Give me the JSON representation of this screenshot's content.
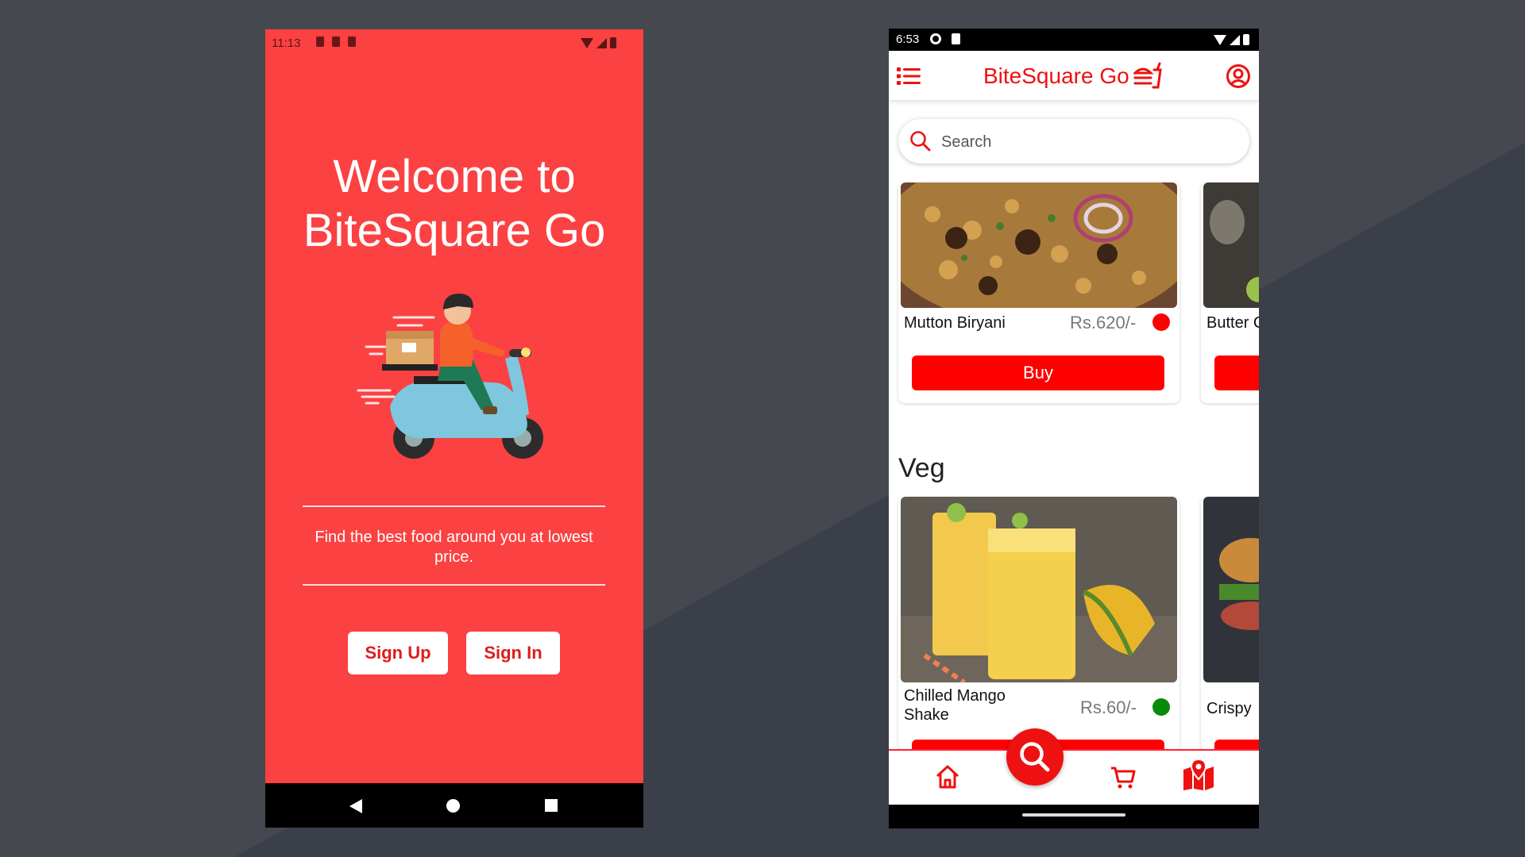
{
  "welcome_screen": {
    "status_time": "11:13",
    "title_line1": "Welcome to",
    "title_line2": "BiteSquare Go",
    "tagline": "Find the best food around you at lowest price.",
    "signup_label": "Sign Up",
    "signin_label": "Sign In",
    "bg_color": "#fb4141"
  },
  "home_screen": {
    "status_time": "6:53",
    "app_title": "BiteSquare Go",
    "search_placeholder": "Search",
    "featured_cards": [
      {
        "name": "Mutton Biryani",
        "price": "Rs.620/-",
        "indicator": "non-veg",
        "indicator_color": "#ff0000",
        "button": "Buy"
      },
      {
        "name": "Butter C",
        "button": ""
      }
    ],
    "section_veg": "Veg",
    "veg_cards": [
      {
        "name": "Chilled Mango Shake",
        "price": "Rs.60/-",
        "indicator": "veg",
        "indicator_color": "#0a8a0a"
      },
      {
        "name": "Crispy"
      }
    ],
    "bottom_nav": [
      "home-icon",
      "search-icon",
      "cart-icon",
      "map-icon"
    ],
    "accent": "#ee1111"
  }
}
